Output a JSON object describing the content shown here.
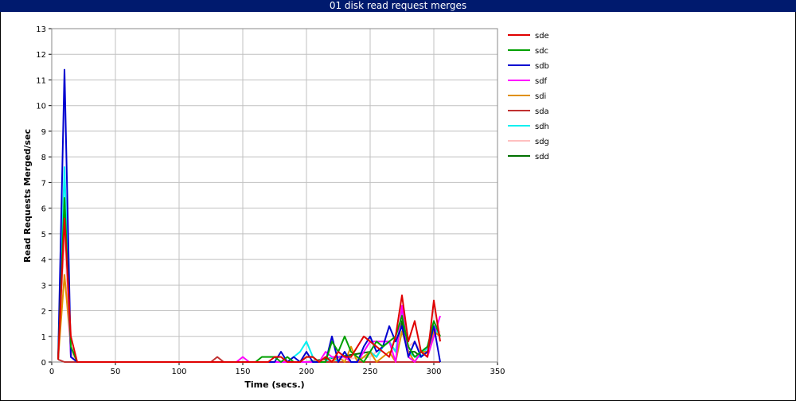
{
  "chart_data": {
    "type": "line",
    "title": "01 disk read request merges",
    "xlabel": "Time (secs.)",
    "ylabel": "Read Requests Merged/sec",
    "xlim": [
      0,
      350
    ],
    "ylim": [
      0,
      13
    ],
    "xticks": [
      "0",
      "50",
      "100",
      "150",
      "200",
      "250",
      "300",
      "350"
    ],
    "yticks": [
      "0",
      "1",
      "2",
      "3",
      "4",
      "5",
      "6",
      "7",
      "8",
      "9",
      "10",
      "11",
      "12",
      "13"
    ],
    "grid": true,
    "legend_position": "right",
    "series": [
      {
        "name": "sde",
        "color": "#e00000",
        "x": [
          5,
          10,
          15,
          20,
          100,
          150,
          165,
          170,
          175,
          180,
          185,
          190,
          195,
          200,
          205,
          210,
          215,
          220,
          225,
          230,
          235,
          240,
          245,
          250,
          255,
          260,
          265,
          270,
          275,
          280,
          285,
          290,
          295,
          300,
          305
        ],
        "y": [
          0.1,
          5.6,
          1.0,
          0,
          0,
          0,
          0,
          0,
          0.2,
          0.2,
          0,
          0,
          0,
          0.2,
          0.2,
          0,
          0.2,
          0,
          0.4,
          0.2,
          0.2,
          0.6,
          1.0,
          0.8,
          0.6,
          0.4,
          0.2,
          1.0,
          2.6,
          0.8,
          1.6,
          0.4,
          0.2,
          2.4,
          0.8
        ]
      },
      {
        "name": "sdc",
        "color": "#00a000",
        "x": [
          5,
          10,
          15,
          20,
          100,
          150,
          160,
          165,
          170,
          175,
          180,
          185,
          190,
          195,
          200,
          205,
          210,
          215,
          220,
          225,
          230,
          235,
          240,
          245,
          250,
          255,
          260,
          265,
          270,
          275,
          280,
          285,
          290,
          295,
          300,
          305
        ],
        "y": [
          0.1,
          6.4,
          0.6,
          0,
          0,
          0,
          0,
          0.2,
          0.2,
          0.2,
          0,
          0.2,
          0,
          0,
          0.2,
          0.2,
          0,
          0,
          0.8,
          0.4,
          1.0,
          0.4,
          0.2,
          0,
          0.4,
          0.8,
          0.6,
          0.8,
          1.0,
          1.8,
          0.6,
          0.2,
          0.4,
          0.6,
          1.6,
          1.0
        ]
      },
      {
        "name": "sdb",
        "color": "#0000d0",
        "x": [
          5,
          10,
          15,
          20,
          100,
          150,
          170,
          175,
          180,
          185,
          190,
          195,
          200,
          205,
          210,
          215,
          220,
          225,
          230,
          235,
          240,
          245,
          250,
          255,
          260,
          265,
          270,
          275,
          280,
          285,
          290,
          295,
          300,
          305
        ],
        "y": [
          0.1,
          11.4,
          0.2,
          0,
          0,
          0,
          0,
          0,
          0.4,
          0,
          0.2,
          0,
          0.4,
          0,
          0,
          0,
          1.0,
          0,
          0.4,
          0,
          0,
          0.6,
          1.0,
          0.4,
          0.6,
          1.4,
          0.8,
          1.4,
          0.2,
          0.8,
          0.2,
          0.4,
          1.4,
          0
        ]
      },
      {
        "name": "sdf",
        "color": "#ff00ff",
        "x": [
          5,
          10,
          15,
          20,
          100,
          145,
          150,
          155,
          200,
          210,
          215,
          220,
          225,
          230,
          235,
          240,
          245,
          250,
          255,
          260,
          265,
          270,
          275,
          280,
          285,
          290,
          295,
          300,
          305
        ],
        "y": [
          0.1,
          6.2,
          0.2,
          0,
          0,
          0,
          0.2,
          0,
          0,
          0,
          0.4,
          0.2,
          0.2,
          0.2,
          0,
          0,
          0.4,
          0.8,
          0.8,
          0.8,
          0.8,
          0,
          2.2,
          0.2,
          0,
          0.4,
          0.2,
          1.0,
          1.8
        ]
      },
      {
        "name": "sdi",
        "color": "#e09000",
        "x": [
          5,
          10,
          15,
          20,
          100,
          150,
          200,
          210,
          215,
          220,
          225,
          230,
          235,
          240,
          245,
          250,
          255,
          260,
          265,
          270,
          275,
          280,
          285,
          290,
          295,
          300,
          305
        ],
        "y": [
          0.1,
          3.4,
          0.6,
          0,
          0,
          0,
          0,
          0,
          0.2,
          0,
          0.2,
          0,
          0.6,
          0,
          0.2,
          0.4,
          0,
          0.2,
          0.4,
          0,
          1.2,
          0.4,
          0,
          0.4,
          0.4,
          1.2,
          1.0
        ]
      },
      {
        "name": "sda",
        "color": "#c03030",
        "x": [
          5,
          10,
          100,
          125,
          130,
          135,
          150,
          200,
          300,
          305
        ],
        "y": [
          0.1,
          0,
          0,
          0,
          0.2,
          0,
          0,
          0,
          0,
          0
        ]
      },
      {
        "name": "sdh",
        "color": "#00f0f0",
        "x": [
          5,
          10,
          15,
          20,
          100,
          150,
          185,
          190,
          195,
          200,
          205,
          210,
          215,
          220,
          225,
          230,
          235,
          240,
          245,
          250,
          255,
          260,
          265,
          270,
          275,
          280,
          285,
          290,
          295,
          300,
          305
        ],
        "y": [
          0.1,
          7.6,
          0.2,
          0,
          0,
          0,
          0,
          0.2,
          0.4,
          0.8,
          0.2,
          0,
          0,
          0.2,
          0,
          0.4,
          0,
          0,
          0.2,
          0.4,
          0.2,
          0.6,
          0.8,
          0.4,
          2.0,
          0.4,
          0.2,
          0.2,
          0.6,
          1.4,
          1.0
        ]
      },
      {
        "name": "sdg",
        "color": "#ffc0c0",
        "x": [
          5,
          10,
          15,
          20,
          100,
          150,
          200,
          250,
          255,
          260,
          265,
          270,
          275,
          280,
          285,
          290,
          295,
          300,
          305
        ],
        "y": [
          0.1,
          5.0,
          0.4,
          0,
          0,
          0,
          0,
          0.2,
          0.4,
          0.6,
          0.8,
          0.4,
          2.0,
          0.6,
          0.8,
          0.4,
          0.2,
          1.0,
          1.2
        ]
      },
      {
        "name": "sdd",
        "color": "#007000",
        "x": [
          5,
          10,
          15,
          20,
          100,
          150,
          200,
          250,
          255,
          260,
          265,
          270,
          275,
          280,
          285,
          290,
          295,
          300,
          305
        ],
        "y": [
          0.1,
          5.2,
          0.4,
          0,
          0,
          0,
          0,
          0.4,
          0.2,
          0.6,
          0.8,
          0.4,
          1.6,
          0.4,
          0.4,
          0.2,
          0.6,
          1.2,
          1.0
        ]
      }
    ]
  }
}
